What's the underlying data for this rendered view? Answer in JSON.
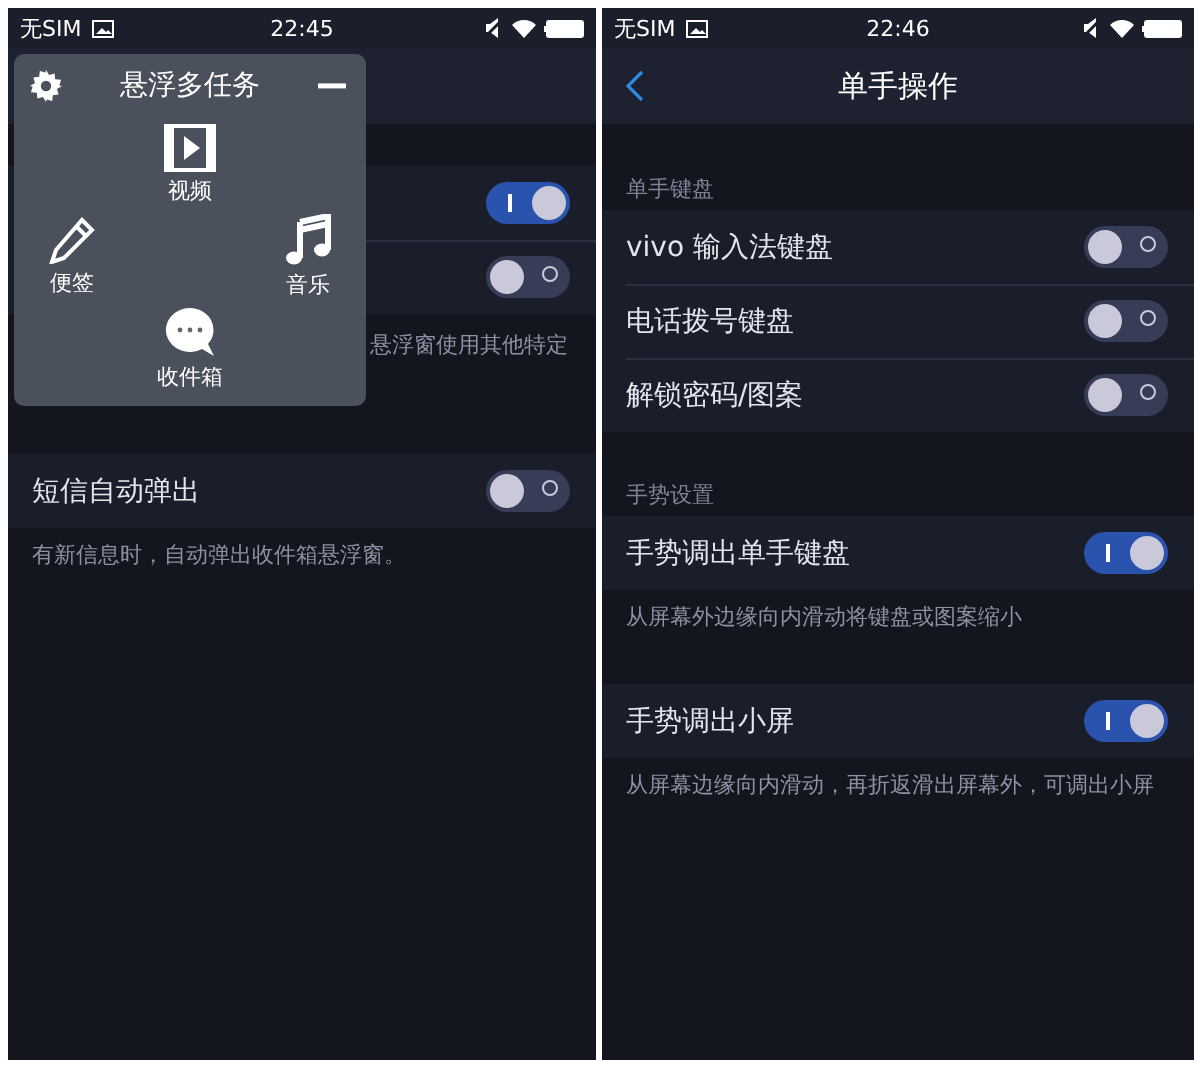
{
  "screens": [
    {
      "status_bar": {
        "carrier": "无SIM",
        "time": "22:45"
      },
      "sections": [
        {
          "items": [
            {
              "kind": "toggle",
              "on": true
            },
            {
              "kind": "toggle",
              "on": false
            },
            {
              "kind": "partial_note",
              "text": "悬浮窗使用其他特定"
            }
          ]
        },
        {
          "items": [
            {
              "kind": "toggle",
              "label": "短信自动弹出",
              "on": false
            },
            {
              "kind": "note",
              "text": "有新信息时，自动弹出收件箱悬浮窗。"
            }
          ]
        }
      ],
      "overlay": {
        "title": "悬浮多任务",
        "apps": [
          {
            "label": "视频",
            "kind": "video"
          },
          {
            "label": "便签",
            "kind": "notes"
          },
          {
            "label": "音乐",
            "kind": "music"
          },
          {
            "label": "收件箱",
            "kind": "inbox"
          }
        ]
      }
    },
    {
      "status_bar": {
        "carrier": "无SIM",
        "time": "22:46"
      },
      "header": {
        "title": "单手操作"
      },
      "sections": [
        {
          "heading": "单手键盘",
          "items": [
            {
              "kind": "toggle",
              "label": "vivo 输入法键盘",
              "on": false
            },
            {
              "kind": "toggle",
              "label": "电话拨号键盘",
              "on": false
            },
            {
              "kind": "toggle",
              "label": "解锁密码/图案",
              "on": false
            }
          ]
        },
        {
          "heading": "手势设置",
          "items": [
            {
              "kind": "toggle",
              "label": "手势调出单手键盘",
              "on": true
            },
            {
              "kind": "note",
              "text": "从屏幕外边缘向内滑动将键盘或图案缩小"
            }
          ]
        },
        {
          "items": [
            {
              "kind": "toggle",
              "label": "手势调出小屏",
              "on": true
            },
            {
              "kind": "note",
              "text": "从屏幕边缘向内滑动，再折返滑出屏幕外，可调出小屏"
            }
          ]
        }
      ]
    }
  ]
}
